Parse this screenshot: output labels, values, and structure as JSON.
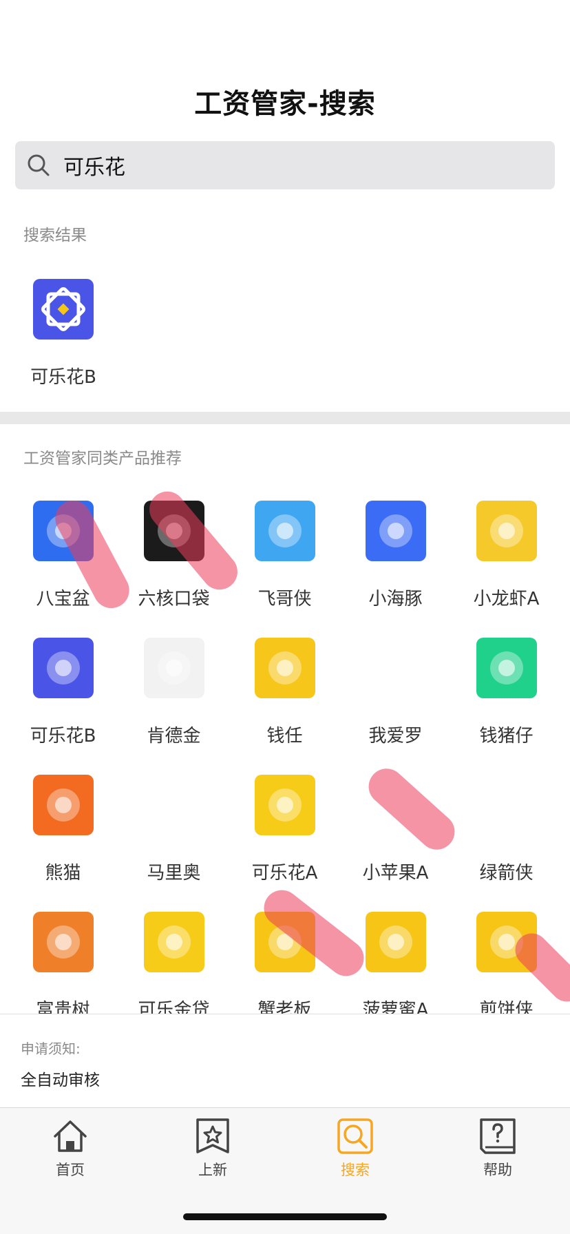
{
  "header": {
    "title": "工资管家-搜索"
  },
  "search": {
    "value": "可乐花"
  },
  "results_section": {
    "label": "搜索结果",
    "items": [
      {
        "name": "可乐花B",
        "icon": "kelehua-b-icon"
      }
    ]
  },
  "recommend_section": {
    "label": "工资管家同类产品推荐",
    "items": [
      {
        "name": "八宝盆",
        "icon": "babaopen-icon",
        "bg": "#2f6df0"
      },
      {
        "name": "六核口袋",
        "icon": "liuhe-icon",
        "bg": "#1b1b1b"
      },
      {
        "name": "飞哥侠",
        "icon": "feigexia-icon",
        "bg": "#3fa6f2"
      },
      {
        "name": "小海豚",
        "icon": "dolphin-icon",
        "bg": "#3b6cf6"
      },
      {
        "name": "小龙虾A",
        "icon": "crayfish-icon",
        "bg": "#f6c92a"
      },
      {
        "name": "可乐花B",
        "icon": "kelehua-b-icon",
        "bg": "#4a55e8"
      },
      {
        "name": "肯德金",
        "icon": "kendejin-icon",
        "bg": "#f2f2f2"
      },
      {
        "name": "钱任",
        "icon": "qianren-icon",
        "bg": "#f7c61b"
      },
      {
        "name": "我爱罗",
        "icon": "gaara-icon",
        "bg": "#ffffff"
      },
      {
        "name": "钱猪仔",
        "icon": "piggy-icon",
        "bg": "#1fd18a"
      },
      {
        "name": "熊猫",
        "icon": "panda-icon",
        "bg": "#f26b21"
      },
      {
        "name": "马里奥",
        "icon": "mario-icon",
        "bg": "#ffffff"
      },
      {
        "name": "可乐花A",
        "icon": "kelehua-a-icon",
        "bg": "#f7cc18"
      },
      {
        "name": "小苹果A",
        "icon": "apple-icon",
        "bg": "#ffffff"
      },
      {
        "name": "绿箭侠",
        "icon": "archer-icon",
        "bg": "#ffffff"
      },
      {
        "name": "富贵树",
        "icon": "tree-icon",
        "bg": "#f07f2a"
      },
      {
        "name": "可乐金贷",
        "icon": "kelejindai-icon",
        "bg": "#f7cc18"
      },
      {
        "name": "蟹老板",
        "icon": "crab-icon",
        "bg": "#f6c516"
      },
      {
        "name": "菠萝蜜A",
        "icon": "boluomi-icon",
        "bg": "#f6c516"
      },
      {
        "name": "煎饼侠",
        "icon": "jianbingxia-icon",
        "bg": "#f6c516"
      }
    ]
  },
  "notice": {
    "label": "申请须知:",
    "text": "全自动审核"
  },
  "tabbar": {
    "tabs": [
      {
        "label": "首页",
        "icon": "home-icon"
      },
      {
        "label": "上新",
        "icon": "star-bookmark-icon"
      },
      {
        "label": "搜索",
        "icon": "search-icon",
        "active": true
      },
      {
        "label": "帮助",
        "icon": "help-icon"
      }
    ]
  },
  "colors": {
    "accent": "#f5a623",
    "background": "#ffffff",
    "section_label": "#8a8a8a"
  }
}
